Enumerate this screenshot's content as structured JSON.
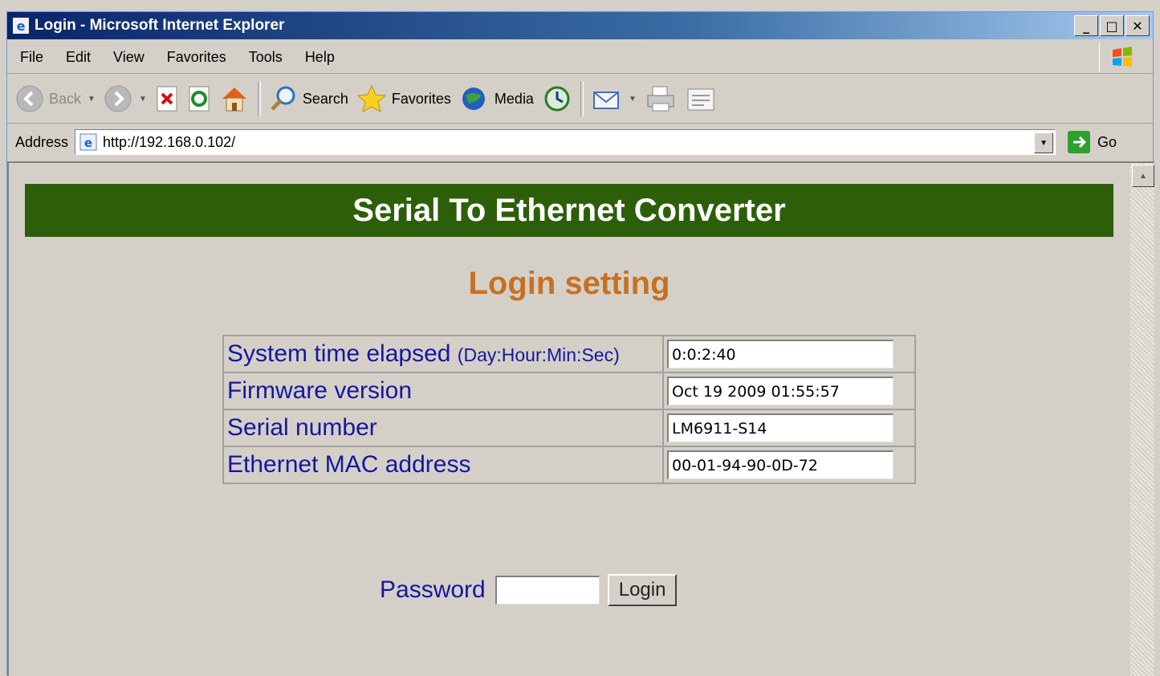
{
  "window": {
    "title": "Login - Microsoft Internet Explorer",
    "minimize": "_",
    "maximize": "□",
    "close": "✕"
  },
  "menu": [
    "File",
    "Edit",
    "View",
    "Favorites",
    "Tools",
    "Help"
  ],
  "toolbar": {
    "back_label": "Back",
    "search_label": "Search",
    "favorites_label": "Favorites",
    "media_label": "Media"
  },
  "address": {
    "label": "Address",
    "url": "http://192.168.0.102/",
    "go_label": "Go"
  },
  "page": {
    "banner": "Serial To Ethernet Converter",
    "heading": "Login setting",
    "rows": [
      {
        "label": "System time elapsed",
        "hint": "(Day:Hour:Min:Sec)",
        "value": "0:0:2:40"
      },
      {
        "label": "Firmware version",
        "hint": "",
        "value": "Oct 19 2009 01:55:57"
      },
      {
        "label": "Serial number",
        "hint": "",
        "value": "LM6911-S14"
      },
      {
        "label": "Ethernet MAC address",
        "hint": "",
        "value": "00-01-94-90-0D-72"
      }
    ],
    "password_label": "Password",
    "password_value": "",
    "login_button": "Login"
  },
  "colors": {
    "banner_bg": "#2d5f0a",
    "heading": "#c87020",
    "label_text": "#1616a0"
  }
}
